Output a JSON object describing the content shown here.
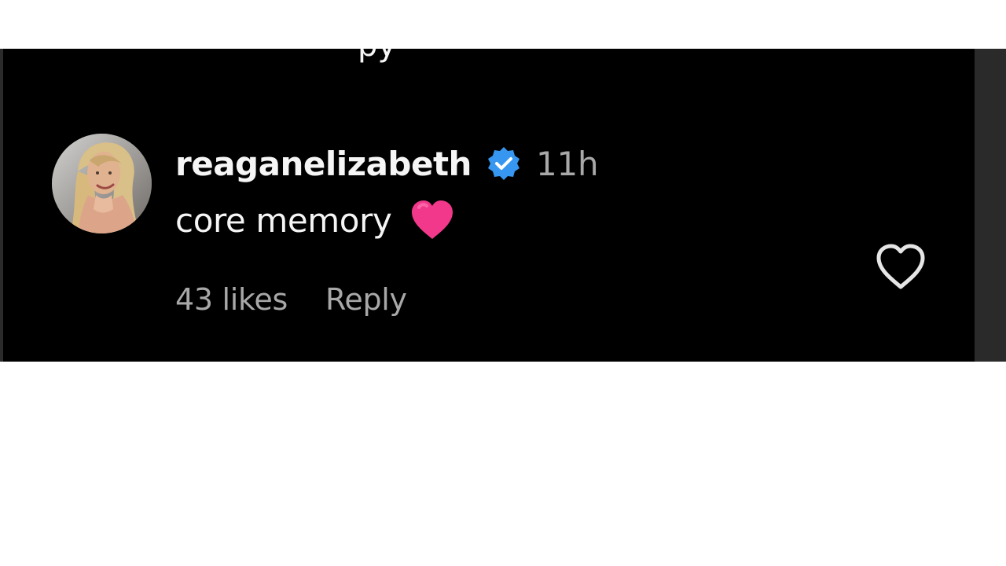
{
  "overflow_line": {
    "text": "py"
  },
  "comment": {
    "username": "reaganelizabeth",
    "timestamp": "11h",
    "text": "core memory",
    "emoji": "heart",
    "likes_label": "43 likes",
    "reply_label": "Reply",
    "verified_icon": "verified-badge-icon",
    "like_icon": "heart-outline-icon",
    "avatar_icon": "profile-avatar"
  },
  "colors": {
    "background": "#000000",
    "text_primary": "#f5f5f5",
    "text_secondary": "#a8a8a8",
    "verified": "#3797f0",
    "emoji_heart": "#f2388b",
    "like_outline": "#e6e6e6",
    "page_background": "#ffffff"
  }
}
